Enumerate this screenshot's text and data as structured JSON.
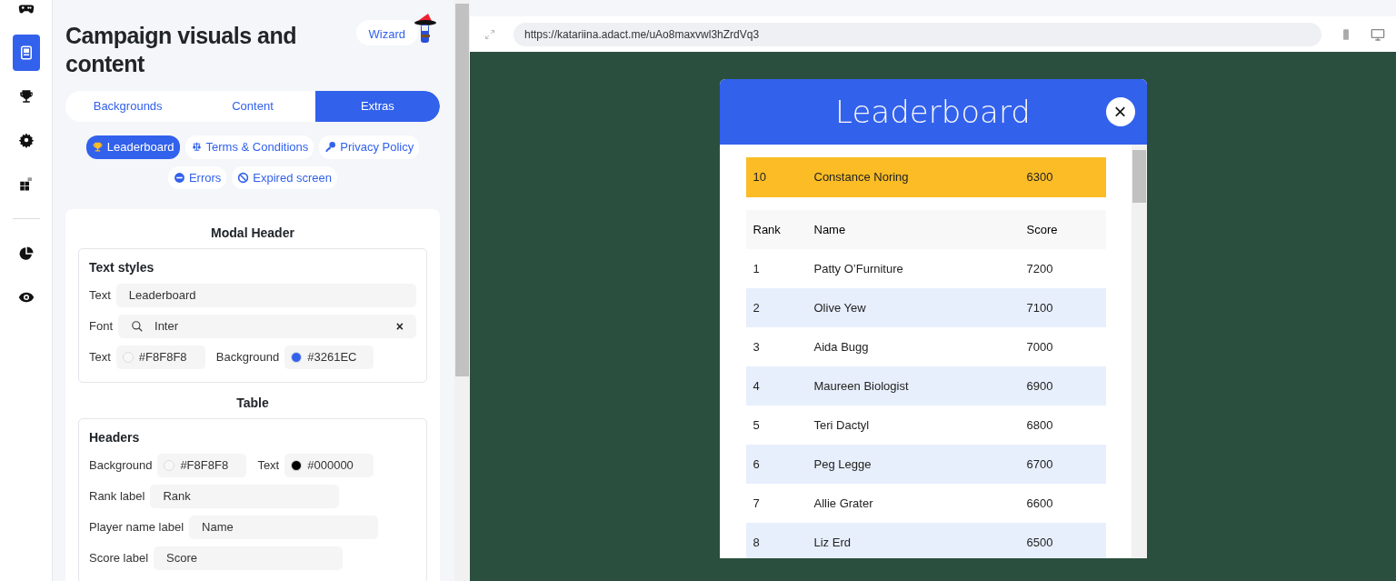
{
  "rail": {
    "items": [
      {
        "kind": "gamepad",
        "selected": false
      },
      {
        "kind": "card",
        "selected": true
      },
      {
        "kind": "trophy",
        "selected": false
      },
      {
        "kind": "gear",
        "selected": false
      },
      {
        "kind": "blocks",
        "selected": false
      },
      {
        "kind": "pie",
        "selected": false
      },
      {
        "kind": "eye",
        "selected": false
      }
    ]
  },
  "panel": {
    "title": "Campaign visuals and content",
    "wizard": "Wizard",
    "tabs": [
      {
        "label": "Backgrounds",
        "selected": false
      },
      {
        "label": "Content",
        "selected": false
      },
      {
        "label": "Extras",
        "selected": true
      }
    ],
    "chips": [
      {
        "label": "Leaderboard",
        "kind": "trophy",
        "selected": true
      },
      {
        "label": "Terms & Conditions",
        "kind": "scale",
        "selected": false
      },
      {
        "label": "Privacy Policy",
        "kind": "key",
        "selected": false
      },
      {
        "label": "Errors",
        "kind": "minus",
        "selected": false
      },
      {
        "label": "Expired screen",
        "kind": "ban",
        "selected": false
      }
    ],
    "sections": [
      {
        "title": "Modal Header",
        "groups": [
          {
            "title": "Text styles",
            "rows": [
              [
                {
                  "kind": "text",
                  "label": "Text",
                  "value": "Leaderboard"
                }
              ],
              [
                {
                  "kind": "search",
                  "label": "Font",
                  "value": "Inter",
                  "clear": "×"
                }
              ],
              [
                {
                  "kind": "color",
                  "label": "Text",
                  "value": "#F8F8F8",
                  "color": "#f8f8f8"
                },
                {
                  "kind": "color",
                  "label": "Background",
                  "value": "#3261EC",
                  "color": "#3261ec"
                }
              ]
            ]
          }
        ]
      },
      {
        "title": "Table",
        "groups": [
          {
            "title": "Headers",
            "rows": [
              [
                {
                  "kind": "color",
                  "label": "Background",
                  "value": "#F8F8F8",
                  "color": "#f8f8f8"
                },
                {
                  "kind": "color",
                  "label": "Text",
                  "value": "#000000",
                  "color": "#000000"
                }
              ],
              [
                {
                  "kind": "text",
                  "label": "Rank label",
                  "value": "Rank"
                }
              ],
              [
                {
                  "kind": "text",
                  "label": "Player name label",
                  "value": "Name"
                }
              ],
              [
                {
                  "kind": "text",
                  "label": "Score label",
                  "value": "Score"
                }
              ]
            ]
          }
        ]
      }
    ]
  },
  "preview": {
    "url": "https://katariina.adact.me/uAo8maxvwl3hZrdVq3",
    "modal": {
      "title": "Leaderboard",
      "close": "×",
      "current": {
        "rank": "10",
        "name": "Constance Noring",
        "score": "6300"
      },
      "columns": [
        "Rank",
        "Name",
        "Score"
      ],
      "rows": [
        {
          "rank": "1",
          "name": "Patty O’Furniture",
          "score": "7200"
        },
        {
          "rank": "2",
          "name": "Olive Yew",
          "score": "7100"
        },
        {
          "rank": "3",
          "name": "Aida Bugg",
          "score": "7000"
        },
        {
          "rank": "4",
          "name": "Maureen Biologist",
          "score": "6900"
        },
        {
          "rank": "5",
          "name": "Teri Dactyl",
          "score": "6800"
        },
        {
          "rank": "6",
          "name": "Peg Legge",
          "score": "6700"
        },
        {
          "rank": "7",
          "name": "Allie Grater",
          "score": "6600"
        },
        {
          "rank": "8",
          "name": "Liz Erd",
          "score": "6500"
        }
      ]
    }
  }
}
